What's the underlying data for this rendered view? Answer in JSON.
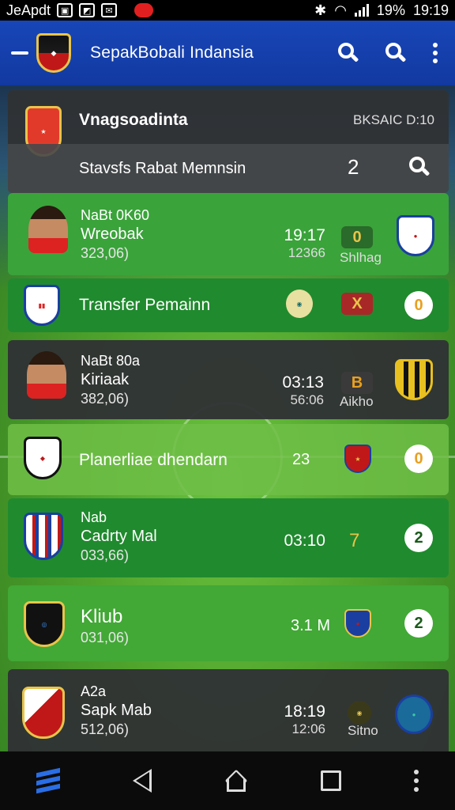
{
  "statusbar": {
    "carrier": "JeApdt",
    "battery": "19%",
    "time": "19:19"
  },
  "appbar": {
    "title": "SepakBobali Indansia"
  },
  "header_card": {
    "team_name": "Vnagsoadinta",
    "meta": "BKSAIC D:10",
    "subtitle": "Stavsfs Rabat Memnsin",
    "count": "2"
  },
  "rows": [
    {
      "line1": "NaBt 0K60",
      "line2": "Wreobak",
      "line3": "323,06)",
      "time": "19:17",
      "time_sub": "12366",
      "score": "0",
      "score_sub": "Shlhag"
    },
    {
      "label": "Transfer Pemainn",
      "badge": "X",
      "circle": "0"
    },
    {
      "line1": "NaBt 80a",
      "line2": "Kiriaak",
      "line3": "382,06)",
      "time": "03:13",
      "time_sub": "56:06",
      "score": "B",
      "score_sub": "Aikho"
    },
    {
      "label": "Planerliae dhendarn",
      "value": "23",
      "circle": "0"
    },
    {
      "line1": "Nab",
      "line2": "Cadrty Mal",
      "line3": "033,66)",
      "time": "03:10",
      "score": "7",
      "circle": "2"
    },
    {
      "line2": "Kliub",
      "line3": "031,06)",
      "value": "3.1 M",
      "circle": "2"
    },
    {
      "line1": "A2a",
      "line2": "Sapk Mab",
      "line3": "512,06)",
      "time": "18:19",
      "time_sub": "12:06",
      "score_sub": "Sitno"
    }
  ],
  "colors": {
    "appbar": "#1846b8",
    "row_dark": "#303234",
    "row_green": "#3aa33a",
    "row_dark_green": "#208a2e",
    "score_pill": "#1e7a1e",
    "accent_gold": "#e8c44a"
  }
}
